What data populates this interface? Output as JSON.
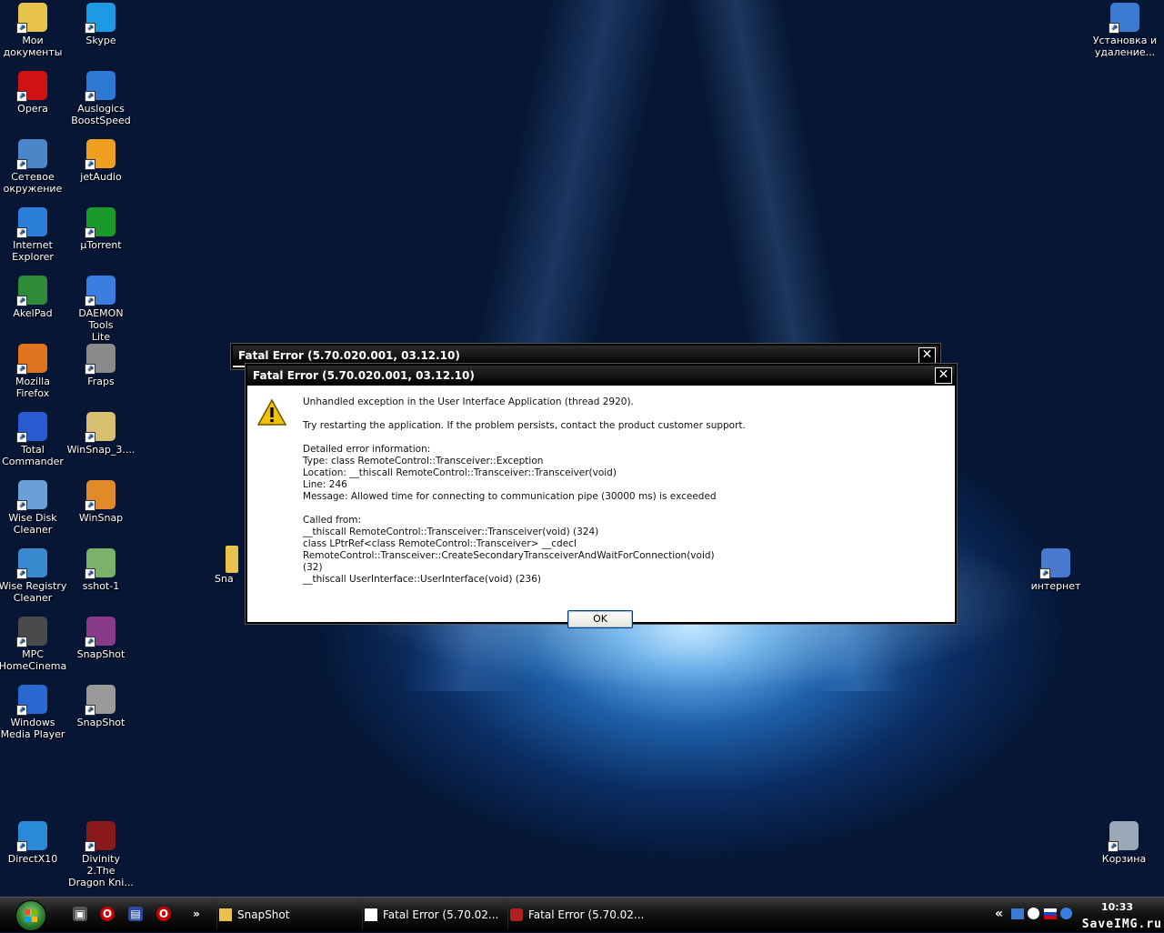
{
  "desktop": {
    "icons_left": [
      {
        "label": "Мои\nдокументы",
        "icon": "folder-icon",
        "color": "#e8c24a"
      },
      {
        "label": "Skype",
        "icon": "skype-icon",
        "color": "#1c9be4"
      },
      {
        "label": "Opera",
        "icon": "opera-icon",
        "color": "#d01212"
      },
      {
        "label": "Auslogics\nBoostSpeed",
        "icon": "boostspeed-icon",
        "color": "#2c78d4"
      },
      {
        "label": "Сетевое\nокружение",
        "icon": "network-icon",
        "color": "#4a86c8"
      },
      {
        "label": "jetAudio",
        "icon": "jetaudio-icon",
        "color": "#f0a020"
      },
      {
        "label": "Internet\nExplorer",
        "icon": "ie-icon",
        "color": "#2b7fd8"
      },
      {
        "label": "µTorrent",
        "icon": "utorrent-icon",
        "color": "#1a9a2a"
      },
      {
        "label": "AkelPad",
        "icon": "akelpad-icon",
        "color": "#2e8b3a"
      },
      {
        "label": "DAEMON Tools\nLite",
        "icon": "daemon-tools-icon",
        "color": "#3a7fe0"
      },
      {
        "label": "Mozilla Firefox",
        "icon": "firefox-icon",
        "color": "#e0741e"
      },
      {
        "label": "Fraps",
        "icon": "fraps-icon",
        "color": "#8a8a8a"
      },
      {
        "label": "Total\nCommander",
        "icon": "total-commander-icon",
        "color": "#2a5ad0"
      },
      {
        "label": "WinSnap_3....",
        "icon": "winsnap-installer-icon",
        "color": "#d8c070"
      },
      {
        "label": "Wise Disk\nCleaner",
        "icon": "wise-disk-icon",
        "color": "#6aa0d8"
      },
      {
        "label": "WinSnap",
        "icon": "winsnap-icon",
        "color": "#e08a2a"
      },
      {
        "label": "Wise Registry\nCleaner",
        "icon": "wise-registry-icon",
        "color": "#3a8ad0"
      },
      {
        "label": "sshot-1",
        "icon": "image-icon",
        "color": "#7ab26a"
      },
      {
        "label": "MPC\nHomeCinema",
        "icon": "mpc-icon",
        "color": "#4a4a4a"
      },
      {
        "label": "SnapShot",
        "icon": "winrar-icon",
        "color": "#8a3a8a"
      },
      {
        "label": "Windows\nMedia Player",
        "icon": "wmp-icon",
        "color": "#2a6ad0"
      },
      {
        "label": "SnapShot",
        "icon": "camera-icon",
        "color": "#9a9a9a"
      },
      {
        "label": "DirectX10",
        "icon": "directx-icon",
        "color": "#2a8ad8"
      },
      {
        "label": "Divinity 2.The\nDragon Kni...",
        "icon": "divinity-icon",
        "color": "#8a1a1a"
      }
    ],
    "icons_right": [
      {
        "label": "Установка и\nудаление...",
        "icon": "add-remove-programs-icon",
        "color": "#3a7ad0"
      },
      {
        "label": "интернет",
        "icon": "internet-connection-icon",
        "color": "#4a7ad0"
      },
      {
        "label": "Корзина",
        "icon": "recycle-bin-icon",
        "color": "#9aa8b8"
      }
    ],
    "partial_icon_label": "Sna"
  },
  "back_dialog": {
    "title": "Fatal Error (5.70.020.001, 03.12.10)",
    "close": "✕"
  },
  "dialog": {
    "title": "Fatal Error (5.70.020.001, 03.12.10)",
    "close": "✕",
    "line1": "Unhandled exception in the User Interface Application (thread 2920).",
    "line2": "Try restarting the application. If the problem persists, contact the product customer support.",
    "details": "Detailed error information:\nType: class RemoteControl::Transceiver::Exception\nLocation: __thiscall RemoteControl::Transceiver::Transceiver(void)\nLine: 246\nMessage: Allowed time for connecting to communication pipe (30000 ms) is exceeded",
    "called": "Called from:\n__thiscall RemoteControl::Transceiver::Transceiver(void) (324)\nclass LPtrRef<class RemoteControl::Transceiver> __cdecl RemoteControl::Transceiver::CreateSecondaryTransceiverAndWaitForConnection(void)\n(32)\n__thiscall UserInterface::UserInterface(void) (236)",
    "ok": "OK"
  },
  "taskbar": {
    "quicklaunch_more": "»",
    "tasks": [
      "SnapShot",
      "Fatal Error (5.70.02...",
      "Fatal Error (5.70.02..."
    ],
    "tray_expand": "«",
    "clock": "10:33",
    "watermark": "SaveIMG.ru"
  }
}
